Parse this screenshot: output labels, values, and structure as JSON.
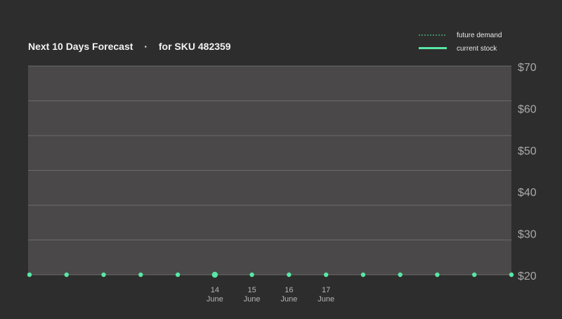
{
  "chart_data": {
    "type": "line",
    "title": "Next 10 Days Forecast",
    "separator": "·",
    "subtitle": "for SKU 482359",
    "xlabel": "",
    "ylabel": "",
    "x_tick_labels": [
      {
        "day": "14",
        "month": "June"
      },
      {
        "day": "15",
        "month": "June"
      },
      {
        "day": "16",
        "month": "June"
      },
      {
        "day": "17",
        "month": "June"
      }
    ],
    "y_ticks": [
      20,
      30,
      40,
      50,
      60,
      70
    ],
    "y_tick_labels": [
      "$20",
      "$30",
      "$40",
      "$50",
      "$60",
      "$70"
    ],
    "ylim": [
      20,
      70
    ],
    "y_gridlines": [
      20,
      30,
      40,
      50,
      60,
      70
    ],
    "grid": true,
    "legend_position": "top-right",
    "series": [
      {
        "name": "future demand",
        "style": "dashed",
        "color": "#59e6a6",
        "values": []
      },
      {
        "name": "current stock",
        "style": "solid",
        "color": "#59e6a6",
        "point_count": 14,
        "values": [
          20,
          20,
          20,
          20,
          20,
          20,
          20,
          20,
          20,
          20,
          20,
          20,
          20,
          20
        ],
        "highlight_index": 5
      }
    ],
    "colors": {
      "background": "#2d2d2d",
      "plot_area": "#4a4849",
      "gridline": "#6c6a6b",
      "accent": "#59e6a6"
    }
  }
}
